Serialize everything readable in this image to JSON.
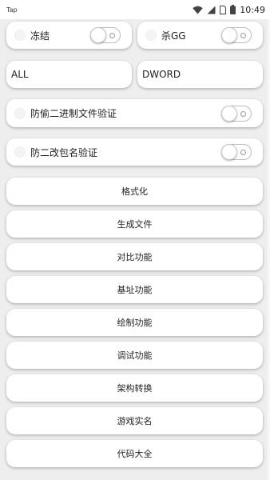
{
  "status_bar": {
    "app": "Tap",
    "time": "10:49",
    "icons": [
      "wifi-icon",
      "signal-icon",
      "sim-icon",
      "battery-icon"
    ]
  },
  "top_switches": [
    {
      "label": "冻结",
      "on": false
    },
    {
      "label": "杀GG",
      "on": false
    }
  ],
  "fields": [
    {
      "value": "ALL"
    },
    {
      "value": "DWORD"
    }
  ],
  "verify_switches": [
    {
      "label": "防偷二进制文件验证",
      "on": false
    },
    {
      "label": "防二改包名验证",
      "on": false
    }
  ],
  "buttons": [
    "格式化",
    "生成文件",
    "对比功能",
    "基址功能",
    "绘制功能",
    "调试功能",
    "架构转换",
    "游戏实名",
    "代码大全"
  ]
}
